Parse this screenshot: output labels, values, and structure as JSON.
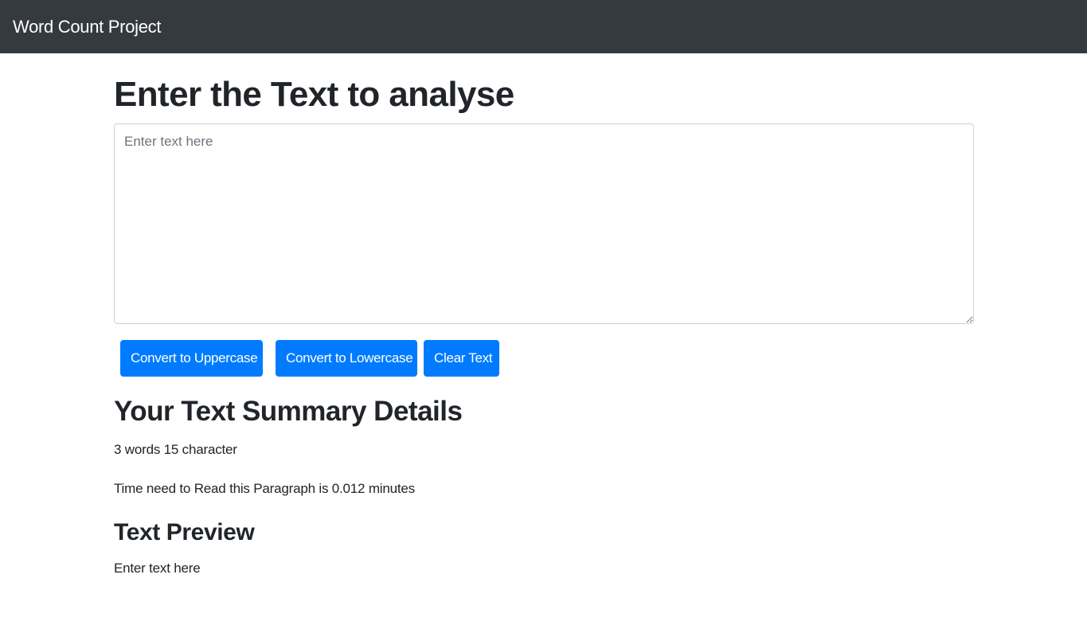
{
  "navbar": {
    "brand": "Word Count Project"
  },
  "main": {
    "heading": "Enter the Text to analyse",
    "textarea": {
      "value": "",
      "placeholder": "Enter text here"
    },
    "buttons": {
      "uppercase": "Convert to Uppercase",
      "lowercase": "Convert to Lowercase",
      "clear": "Clear Text"
    }
  },
  "summary": {
    "heading": "Your Text Summary Details",
    "counts": "3 words 15 character",
    "read_time": "Time need to Read this Paragraph is 0.012 minutes"
  },
  "preview": {
    "heading": "Text Preview",
    "text": "Enter text here"
  },
  "colors": {
    "navbar_bg": "#343a40",
    "primary": "#007bff",
    "text": "#212529"
  }
}
